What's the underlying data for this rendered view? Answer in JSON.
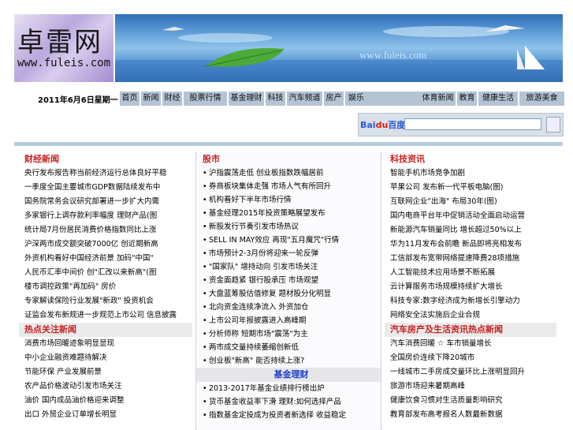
{
  "banner": {
    "logo_cn": "卓雷网",
    "logo_en": "www.fuleis.com",
    "sky_text": "www.fuleis.com"
  },
  "date": "2011年6月6日星期一",
  "nav": [
    {
      "label": "首页"
    },
    {
      "label": "新闻"
    },
    {
      "label": "财经"
    },
    {
      "label": "股票行情"
    },
    {
      "label": "基金理财"
    },
    {
      "label": "科技"
    },
    {
      "label": "汽车频道"
    },
    {
      "label": "房产"
    },
    {
      "label": "娱乐"
    },
    {
      "label": "体育新闻"
    },
    {
      "label": "教育"
    },
    {
      "label": "健康生活"
    },
    {
      "label": "旅游美食"
    }
  ],
  "search": {
    "brand": "Bai",
    "brand2": "du",
    "brand3": "百度",
    "placeholder": "",
    "button": ""
  },
  "left": {
    "title1": "财经新闻",
    "items1": [
      "央行发布报告称当前经济运行总体良好平稳",
      "一季度全国主要城市GDP数据陆续发布中",
      "国务院常务会议研究部署进一步扩大内需",
      "多家银行上调存款利率幅度 理财产品(图",
      "统计局7月份居民消费价格指数同比上涨",
      "沪深两市成交额突破7000亿 创近期新高",
      "外资机构看好中国经济前景 加码\"中国\"",
      "人民币汇率中间价 创\"汇改以来新高\"(图",
      "楼市调控政策\"再加码\" 房价",
      "专家解读保险行业发展\"新政\" 投资机会",
      "证监会发布新规进一步规范上市公司 信息披露"
    ],
    "title2": "热点关注新闻",
    "items2": [
      "消费市场回暖迹象明显显现",
      "中小企业融资难题待解决",
      "节能环保 产业发展前景",
      "农产品价格波动引发市场关注",
      "油价 国内成品油价格迎来调整",
      "出口 外贸企业订单增长明显"
    ]
  },
  "mid": {
    "title1": "股市",
    "items1": [
      "沪指震荡走低 创业板指数跌幅居前",
      "券商板块集体走强 市场人气有所回升",
      "机构看好下半年市场行情",
      "基金经理2015年投资策略展望发布",
      "新股发行节奏引发市场热议",
      "SELL IN MAY效应 再现\"五月魔咒\"行情",
      "市场预计2-3月份将迎来一轮反弹",
      "\"国家队\" 增持动向 引发市场关注",
      "资金面趋紧 银行股承压 市场观望",
      "大盘蓝筹股估值修复 题材股分化明显",
      "北向资金连续净流入 外资加仓",
      "上市公司年报披露进入高峰期",
      "分析师称 短期市场\"震荡\"为主",
      "两市成交量持续萎缩创新低",
      "创业板\"新高\" 能否持续上涨?"
    ],
    "title2": "基金理财",
    "items2": [
      "2013-2017年基金业绩排行榜出炉",
      "货币基金收益率下滑 理财:如何选择产品",
      "指数基金定投成为投资者新选择 收益稳定"
    ]
  },
  "right": {
    "title1": "科技资讯",
    "items1": [
      "智能手机市场竞争加剧",
      "苹果公司 发布新一代平板电脑(图)",
      "互联网企业\"出海\" 布局30年(图)",
      "国内电商平台年中促销活动全面启动运营",
      "新能源汽车销量同比 增长超过50%以上",
      "华为11月发布会前瞻 新品即将亮相发布",
      "工信部发布宽带网络提速降费28项措施",
      "人工智能技术应用场景不断拓展",
      "云计算服务市场规模持续扩大增长",
      "科技专家:数字经济成为新增长引擎动力",
      "网络安全法实施后企业合规"
    ],
    "title2": "汽车房产及生活资讯热点新闻",
    "items2": [
      "汽车消费回暖 ☆ 车市销量增长",
      "全国房价连续下降20城市",
      "一线城市二手房成交量环比上涨明显回升",
      "旅游市场迎来暑期高峰",
      "健康饮食习惯对生活质量影响研究",
      "教育部发布高考报名人数最新数据"
    ]
  },
  "colors": {
    "nav_bg": "#b4c4d4",
    "title_red": "#c81e1e",
    "title_blue": "#1f3fc4",
    "divider": "#b8cce0"
  }
}
